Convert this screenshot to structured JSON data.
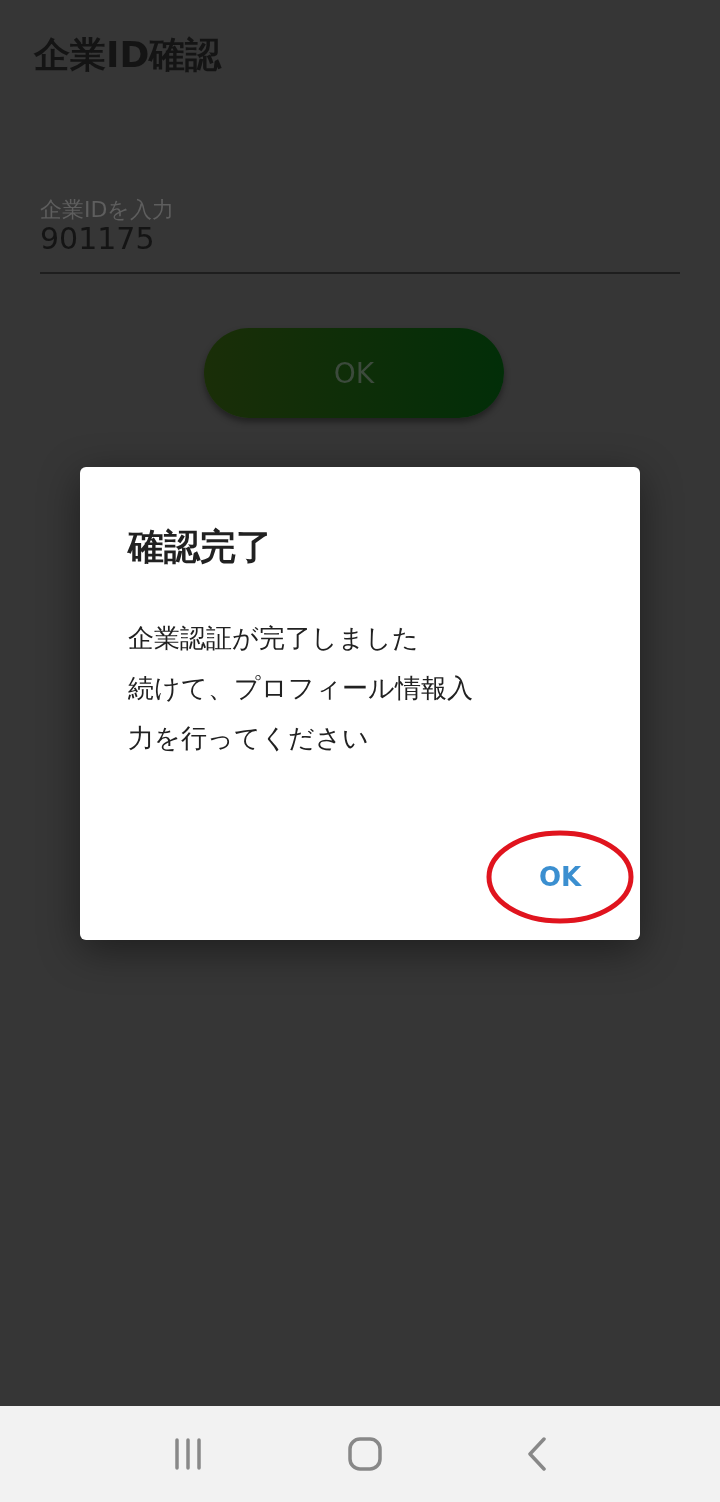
{
  "screen": {
    "title": "企業ID確認",
    "company_id_field": {
      "label": "企業IDを入力",
      "value": "901175"
    },
    "submit_button": {
      "label": "OK"
    }
  },
  "dialog": {
    "title": "確認完了",
    "message_lines": [
      "企業認証が完了しました",
      "続けて、プロフィール情報入",
      "力を行ってください"
    ],
    "ok_button": {
      "label": "OK",
      "highlighted": true
    }
  },
  "nav_bar": {
    "buttons": [
      {
        "kind": "recents"
      },
      {
        "kind": "home"
      },
      {
        "kind": "back"
      }
    ]
  }
}
